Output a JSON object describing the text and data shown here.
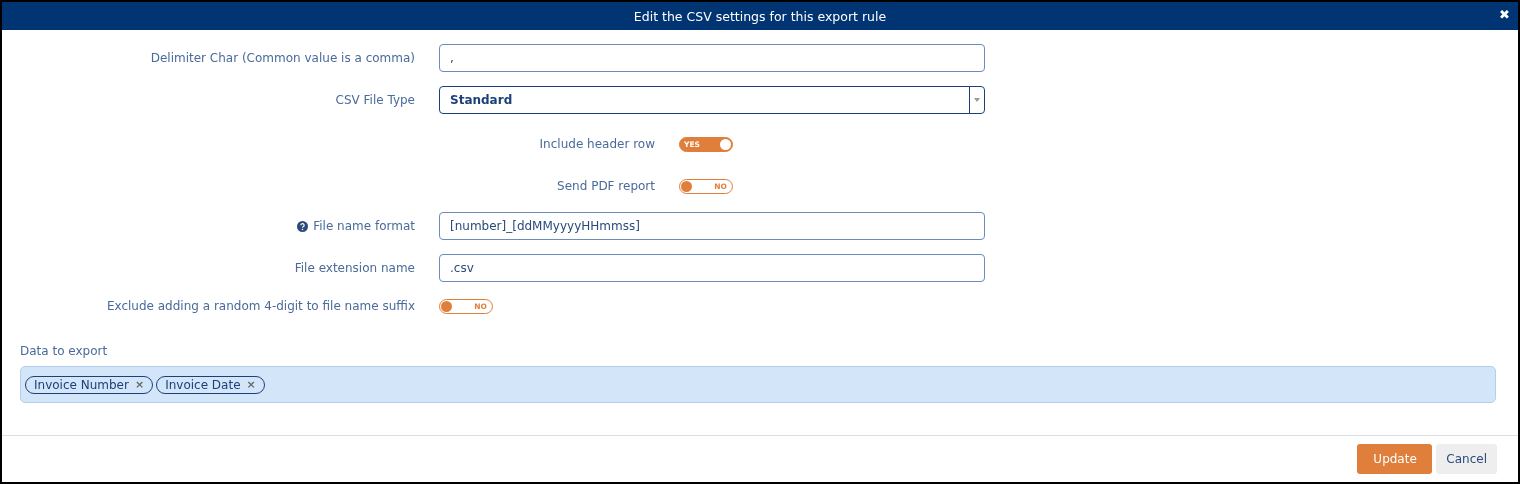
{
  "dialog": {
    "title": "Edit the CSV settings for this export rule",
    "close": "✖"
  },
  "fields": [
    {
      "kind": "text",
      "label": "Delimiter Char (Common value is a comma)",
      "value": ","
    },
    {
      "kind": "select",
      "label": "CSV File Type",
      "value": "Standard"
    },
    {
      "kind": "sub-toggle",
      "label": "Include header row",
      "on": true,
      "text": "YES"
    },
    {
      "kind": "sub-toggle",
      "label": "Send PDF report",
      "on": false,
      "text": "NO"
    },
    {
      "kind": "text",
      "label": "File name format",
      "help": true,
      "value": "[number]_[ddMMyyyyHHmmss]"
    },
    {
      "kind": "text",
      "label": "File extension name",
      "value": ".csv"
    },
    {
      "kind": "toggle",
      "label": "Exclude adding a random 4-digit to file name suffix",
      "on": false,
      "text": "NO"
    }
  ],
  "export": {
    "label": "Data to export",
    "tags": [
      {
        "text": "Invoice Number",
        "remove": "×"
      },
      {
        "text": "Invoice Date",
        "remove": "×"
      }
    ]
  },
  "buttons": [
    {
      "kind": "primary",
      "label": "Update"
    },
    {
      "kind": "secondary",
      "label": "Cancel"
    }
  ]
}
